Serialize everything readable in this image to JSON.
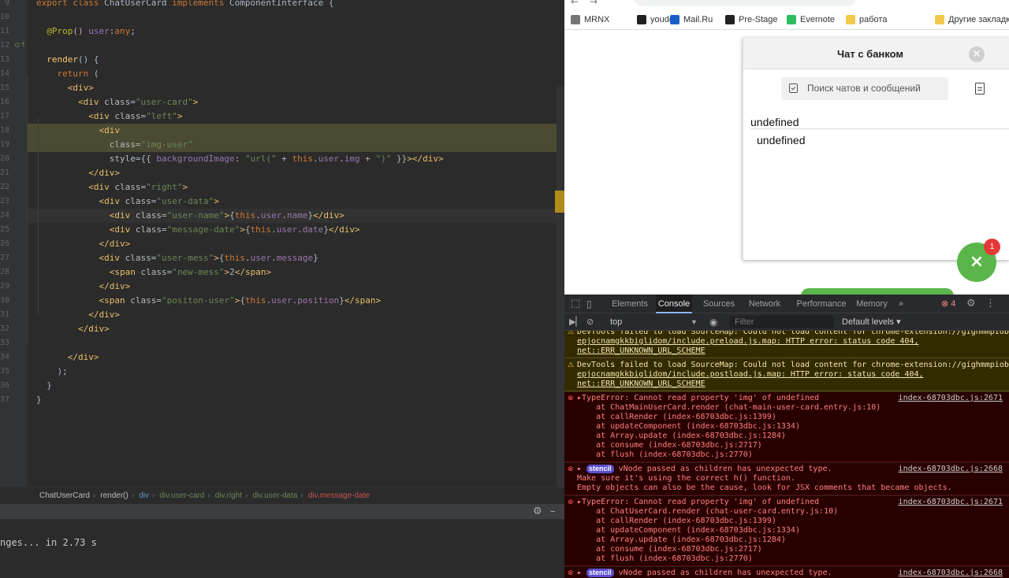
{
  "ide": {
    "line_numbers": [
      "9",
      "10",
      "11",
      "12",
      "13",
      "14",
      "15",
      "16",
      "17",
      "18",
      "19",
      "20",
      "21",
      "22",
      "23",
      "24",
      "25",
      "26",
      "27",
      "28",
      "29",
      "30",
      "31",
      "32",
      "33",
      "34",
      "35",
      "36",
      "37"
    ],
    "code_lines": [
      {
        "indent": "",
        "tokens": [
          {
            "c": "k",
            "t": "export class "
          },
          {
            "c": "pl",
            "t": "ChatUserCard "
          },
          {
            "c": "k",
            "t": "implements "
          },
          {
            "c": "pl",
            "t": "ComponentInterface {"
          }
        ]
      },
      {
        "indent": "",
        "tokens": []
      },
      {
        "indent": "  ",
        "tokens": [
          {
            "c": "an",
            "t": "@Prop"
          },
          {
            "c": "pl",
            "t": "() "
          },
          {
            "c": "pr",
            "t": "user"
          },
          {
            "c": "pl",
            "t": ":"
          },
          {
            "c": "k",
            "t": "any"
          },
          {
            "c": "pl",
            "t": ";"
          }
        ]
      },
      {
        "indent": "",
        "tokens": []
      },
      {
        "indent": "  ",
        "tokens": [
          {
            "c": "fn",
            "t": "render"
          },
          {
            "c": "pl",
            "t": "() {"
          }
        ]
      },
      {
        "indent": "    ",
        "tokens": [
          {
            "c": "k",
            "t": "return "
          },
          {
            "c": "pl",
            "t": "("
          }
        ]
      },
      {
        "indent": "      ",
        "tokens": [
          {
            "c": "tg",
            "t": "<div>"
          }
        ]
      },
      {
        "indent": "        ",
        "tokens": [
          {
            "c": "tg",
            "t": "<div "
          },
          {
            "c": "at",
            "t": "class"
          },
          {
            "c": "pl",
            "t": "="
          },
          {
            "c": "st",
            "t": "\"user-card\""
          },
          {
            "c": "tg",
            "t": ">"
          }
        ]
      },
      {
        "indent": "          ",
        "tokens": [
          {
            "c": "tg",
            "t": "<div "
          },
          {
            "c": "at",
            "t": "class"
          },
          {
            "c": "pl",
            "t": "="
          },
          {
            "c": "st",
            "t": "\"left\""
          },
          {
            "c": "tg",
            "t": ">"
          }
        ]
      },
      {
        "indent": "            ",
        "tokens": [
          {
            "c": "tg",
            "t": "<div"
          }
        ]
      },
      {
        "indent": "              ",
        "tokens": [
          {
            "c": "at",
            "t": "class"
          },
          {
            "c": "pl",
            "t": "="
          },
          {
            "c": "st",
            "t": "\"img-user\""
          }
        ]
      },
      {
        "indent": "              ",
        "tokens": [
          {
            "c": "at",
            "t": "style"
          },
          {
            "c": "pl",
            "t": "={{ "
          },
          {
            "c": "pr",
            "t": "backgroundImage"
          },
          {
            "c": "pl",
            "t": ": "
          },
          {
            "c": "st",
            "t": "\"url(\""
          },
          {
            "c": "pl",
            "t": " + "
          },
          {
            "c": "th",
            "t": "this"
          },
          {
            "c": "pl",
            "t": "."
          },
          {
            "c": "pr",
            "t": "user"
          },
          {
            "c": "pl",
            "t": "."
          },
          {
            "c": "pr",
            "t": "img"
          },
          {
            "c": "pl",
            "t": " + "
          },
          {
            "c": "st",
            "t": "\")\""
          },
          {
            "c": "pl",
            "t": " }}"
          },
          {
            "c": "tg",
            "t": "></div>"
          }
        ]
      },
      {
        "indent": "          ",
        "tokens": [
          {
            "c": "tg",
            "t": "</div>"
          }
        ]
      },
      {
        "indent": "          ",
        "tokens": [
          {
            "c": "tg",
            "t": "<div "
          },
          {
            "c": "at",
            "t": "class"
          },
          {
            "c": "pl",
            "t": "="
          },
          {
            "c": "st",
            "t": "\"right\""
          },
          {
            "c": "tg",
            "t": ">"
          }
        ]
      },
      {
        "indent": "            ",
        "tokens": [
          {
            "c": "tg",
            "t": "<div "
          },
          {
            "c": "at",
            "t": "class"
          },
          {
            "c": "pl",
            "t": "="
          },
          {
            "c": "st",
            "t": "\"user-data\""
          },
          {
            "c": "tg",
            "t": ">"
          }
        ]
      },
      {
        "indent": "              ",
        "tokens": [
          {
            "c": "tg",
            "t": "<div "
          },
          {
            "c": "at",
            "t": "class"
          },
          {
            "c": "pl",
            "t": "="
          },
          {
            "c": "st",
            "t": "\"user-name\""
          },
          {
            "c": "tg",
            "t": ">"
          },
          {
            "c": "pl",
            "t": "{"
          },
          {
            "c": "th",
            "t": "this"
          },
          {
            "c": "pl",
            "t": "."
          },
          {
            "c": "pr",
            "t": "user"
          },
          {
            "c": "pl",
            "t": "."
          },
          {
            "c": "pr",
            "t": "name"
          },
          {
            "c": "pl",
            "t": "}"
          },
          {
            "c": "tg",
            "t": "</div>"
          }
        ]
      },
      {
        "indent": "              ",
        "tokens": [
          {
            "c": "tg",
            "t": "<div "
          },
          {
            "c": "at",
            "t": "class"
          },
          {
            "c": "pl",
            "t": "="
          },
          {
            "c": "st",
            "t": "\"message-date\""
          },
          {
            "c": "tg",
            "t": ">"
          },
          {
            "c": "pl",
            "t": "{"
          },
          {
            "c": "th",
            "t": "this"
          },
          {
            "c": "pl",
            "t": "."
          },
          {
            "c": "pr",
            "t": "user"
          },
          {
            "c": "pl",
            "t": "."
          },
          {
            "c": "pr",
            "t": "date"
          },
          {
            "c": "pl",
            "t": "}"
          },
          {
            "c": "tg",
            "t": "</div>"
          }
        ]
      },
      {
        "indent": "            ",
        "tokens": [
          {
            "c": "tg",
            "t": "</div>"
          }
        ]
      },
      {
        "indent": "            ",
        "tokens": [
          {
            "c": "tg",
            "t": "<div "
          },
          {
            "c": "at",
            "t": "class"
          },
          {
            "c": "pl",
            "t": "="
          },
          {
            "c": "st",
            "t": "\"user-mess\""
          },
          {
            "c": "tg",
            "t": ">"
          },
          {
            "c": "pl",
            "t": "{"
          },
          {
            "c": "th",
            "t": "this"
          },
          {
            "c": "pl",
            "t": "."
          },
          {
            "c": "pr",
            "t": "user"
          },
          {
            "c": "pl",
            "t": "."
          },
          {
            "c": "pr",
            "t": "message"
          },
          {
            "c": "pl",
            "t": "}"
          }
        ]
      },
      {
        "indent": "              ",
        "tokens": [
          {
            "c": "tg",
            "t": "<span "
          },
          {
            "c": "at",
            "t": "class"
          },
          {
            "c": "pl",
            "t": "="
          },
          {
            "c": "st",
            "t": "\"new-mess\""
          },
          {
            "c": "tg",
            "t": ">"
          },
          {
            "c": "pl",
            "t": "2"
          },
          {
            "c": "tg",
            "t": "</span>"
          }
        ]
      },
      {
        "indent": "            ",
        "tokens": [
          {
            "c": "tg",
            "t": "</div>"
          }
        ]
      },
      {
        "indent": "            ",
        "tokens": [
          {
            "c": "tg",
            "t": "<span "
          },
          {
            "c": "at",
            "t": "class"
          },
          {
            "c": "pl",
            "t": "="
          },
          {
            "c": "st",
            "t": "\"positon-user\""
          },
          {
            "c": "tg",
            "t": ">"
          },
          {
            "c": "pl",
            "t": "{"
          },
          {
            "c": "th",
            "t": "this"
          },
          {
            "c": "pl",
            "t": "."
          },
          {
            "c": "pr",
            "t": "user"
          },
          {
            "c": "pl",
            "t": "."
          },
          {
            "c": "pr",
            "t": "position"
          },
          {
            "c": "pl",
            "t": "}"
          },
          {
            "c": "tg",
            "t": "</span>"
          }
        ]
      },
      {
        "indent": "          ",
        "tokens": [
          {
            "c": "tg",
            "t": "</div>"
          }
        ]
      },
      {
        "indent": "        ",
        "tokens": [
          {
            "c": "tg",
            "t": "</div>"
          }
        ]
      },
      {
        "indent": "",
        "tokens": []
      },
      {
        "indent": "      ",
        "tokens": [
          {
            "c": "tg",
            "t": "</div>"
          }
        ]
      },
      {
        "indent": "    ",
        "tokens": [
          {
            "c": "pl",
            "t": ");"
          }
        ]
      },
      {
        "indent": "  ",
        "tokens": [
          {
            "c": "pl",
            "t": "}"
          }
        ]
      },
      {
        "indent": "",
        "tokens": [
          {
            "c": "pl",
            "t": "}"
          }
        ]
      }
    ],
    "breadcrumb": [
      "ChatUserCard",
      "render()",
      "div",
      "div.user-card",
      "div.right",
      "div.user-data",
      "div.message-date"
    ],
    "run_output": "nges... in 2.73 s"
  },
  "browser": {
    "bookmarks": [
      {
        "label": "MRNX",
        "color": "#777777"
      },
      {
        "label": "youdo",
        "color": "#222222"
      },
      {
        "label": "Mail.Ru",
        "color": "#1a5dc7"
      },
      {
        "label": "Pre-Stage",
        "color": "#222222"
      },
      {
        "label": "Evernote",
        "color": "#2dbe60"
      },
      {
        "label": "работа",
        "color": "#f2c94c"
      },
      {
        "label": "Другие закладки",
        "color": "#f2c94c"
      }
    ],
    "chat": {
      "title": "Чат с банком",
      "close_icon": "×",
      "search_placeholder": "Поиск чатов и сообщений",
      "user_name": "undefined",
      "user_date": "undefined",
      "fab_icon": "×",
      "fab_badge": "1",
      "fab_color": "#5bb54a"
    }
  },
  "devtools": {
    "tabs": [
      "Elements",
      "Console",
      "Sources",
      "Network",
      "Performance",
      "Memory",
      "»"
    ],
    "active_tab": "Console",
    "error_count": "4",
    "context": "top",
    "filter_placeholder": "Filter",
    "levels": "Default levels ▾",
    "messages": [
      {
        "type": "warn",
        "lines": [
          "DevTools failed to load SourceMap: Could not load content for chrome-extension://gighmmpiobklf",
          "epjocnamgkkbiglidom/include.preload.js.map: HTTP error: status code 404,",
          "net::ERR_UNKNOWN_URL_SCHEME"
        ],
        "src": ""
      },
      {
        "type": "warn",
        "lines": [
          "DevTools failed to load SourceMap: Could not load content for chrome-extension://gighmmpiobklf",
          "epjocnamgkkbiglidom/include.postload.js.map: HTTP error: status code 404,",
          "net::ERR_UNKNOWN_URL_SCHEME"
        ],
        "src": ""
      },
      {
        "type": "err",
        "lines": [
          "▸TypeError: Cannot read property 'img' of undefined",
          "    at ChatMainUserCard.render (chat-main-user-card.entry.js:10)",
          "    at callRender (index-68703dbc.js:1399)",
          "    at updateComponent (index-68703dbc.js:1334)",
          "    at Array.update (index-68703dbc.js:1284)",
          "    at consume (index-68703dbc.js:2717)",
          "    at flush (index-68703dbc.js:2770)"
        ],
        "src": "index-68703dbc.js:2671"
      },
      {
        "type": "err",
        "badge": "stencil",
        "lines": [
          "▸ stencil vNode passed as children has unexpected type.",
          "Make sure it's using the correct h() function.",
          "Empty objects can also be the cause, look for JSX comments that became objects."
        ],
        "src": "index-68703dbc.js:2668"
      },
      {
        "type": "err",
        "lines": [
          "▸TypeError: Cannot read property 'img' of undefined",
          "    at ChatUserCard.render (chat-user-card.entry.js:10)",
          "    at callRender (index-68703dbc.js:1399)",
          "    at updateComponent (index-68703dbc.js:1334)",
          "    at Array.update (index-68703dbc.js:1284)",
          "    at consume (index-68703dbc.js:2717)",
          "    at flush (index-68703dbc.js:2770)"
        ],
        "src": "index-68703dbc.js:2671"
      },
      {
        "type": "err",
        "badge": "stencil",
        "lines": [
          "▸ stencil vNode passed as children has unexpected type."
        ],
        "src": "index-68703dbc.js:2668"
      }
    ]
  }
}
